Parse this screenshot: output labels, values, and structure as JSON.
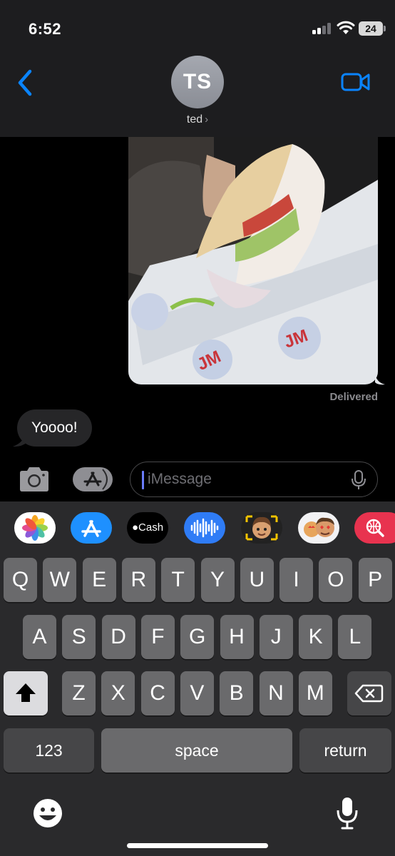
{
  "status_bar": {
    "time": "6:52",
    "battery_level": "24"
  },
  "header": {
    "avatar_initials": "TS",
    "contact_name": "ted",
    "contact_chevron": "›"
  },
  "conversation": {
    "outgoing_image_description": "photo of a half-eaten sub sandwich",
    "delivery_status": "Delivered",
    "incoming_message": "Yoooo!"
  },
  "composer": {
    "placeholder": "iMessage"
  },
  "app_drawer": {
    "cash_label": "Cash"
  },
  "keyboard": {
    "row1": [
      "Q",
      "W",
      "E",
      "R",
      "T",
      "Y",
      "U",
      "I",
      "O",
      "P"
    ],
    "row2": [
      "A",
      "S",
      "D",
      "F",
      "G",
      "H",
      "J",
      "K",
      "L"
    ],
    "row3": [
      "Z",
      "X",
      "C",
      "V",
      "B",
      "N",
      "M"
    ],
    "numbers_key": "123",
    "space_key": "space",
    "return_key": "return"
  },
  "colors": {
    "accent": "#0a84ff",
    "header_bg": "#1d1d1f",
    "incoming_bubble": "#262628",
    "key": "#6a6a6c"
  }
}
